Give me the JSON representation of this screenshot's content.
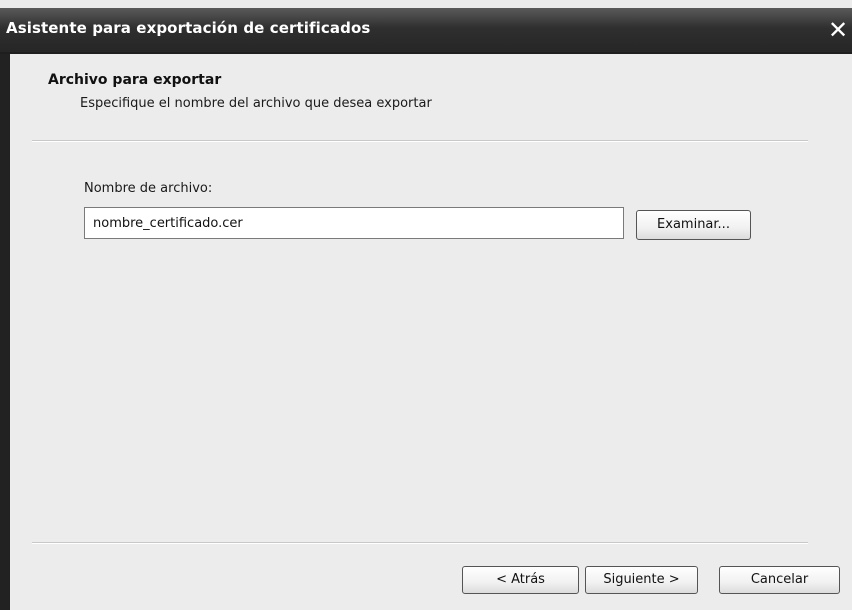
{
  "window": {
    "title": "Asistente para exportación de certificados",
    "close_label": "✕"
  },
  "header": {
    "title": "Archivo para exportar",
    "subtitle": "Especifique el nombre del archivo que desea exportar"
  },
  "form": {
    "filename_label": "Nombre de archivo:",
    "filename_value": "nombre_certificado.cer",
    "browse_label": "Examinar..."
  },
  "footer": {
    "back_label": "< Atrás",
    "next_label": "Siguiente >",
    "cancel_label": "Cancelar"
  }
}
